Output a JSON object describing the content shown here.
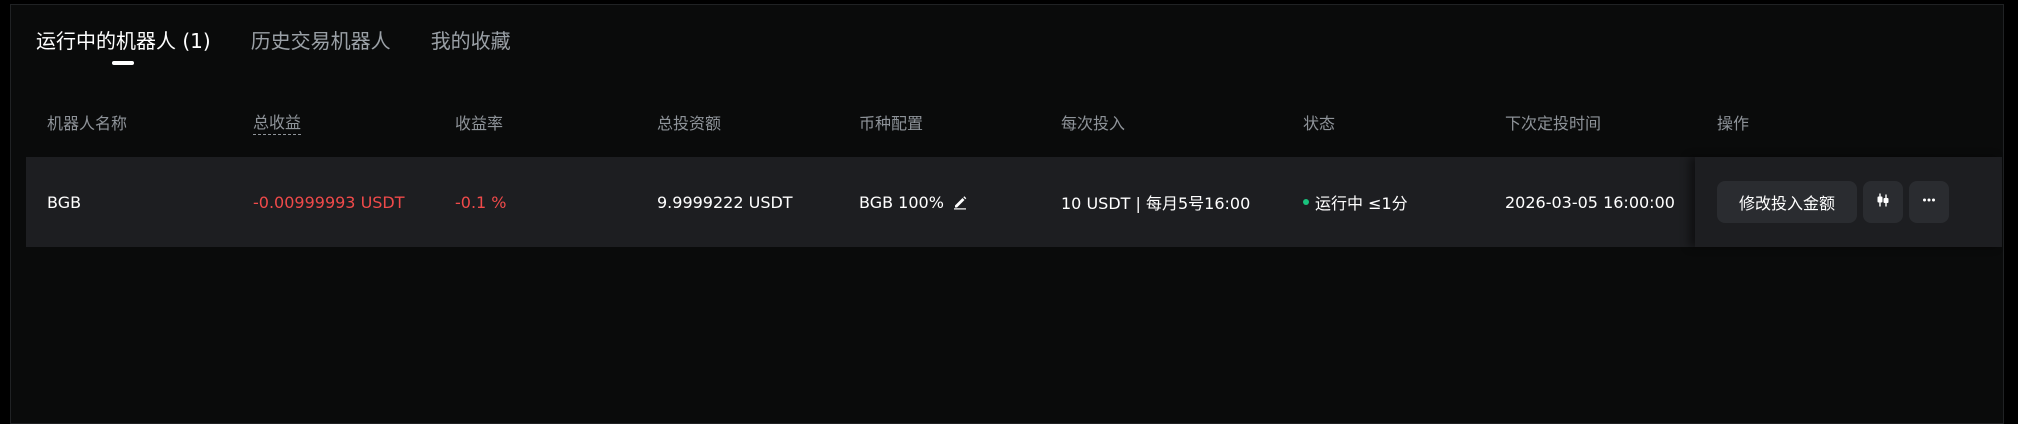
{
  "tabs": [
    {
      "label": "运行中的机器人 (1)",
      "active": true
    },
    {
      "label": "历史交易机器人",
      "active": false
    },
    {
      "label": "我的收藏",
      "active": false
    }
  ],
  "table": {
    "headers": {
      "name": "机器人名称",
      "total_profit": "总收益",
      "profit_rate": "收益率",
      "total_investment": "总投资额",
      "currency_allocation": "币种配置",
      "per_investment": "每次投入",
      "status": "状态",
      "next_investment_time": "下次定投时间",
      "actions": "操作"
    },
    "rows": [
      {
        "name": "BGB",
        "total_profit": "-0.00999993 USDT",
        "profit_rate": "-0.1 %",
        "total_investment": "9.9999222 USDT",
        "currency_allocation": "BGB 100%",
        "per_investment": "10 USDT | 每月5号16:00",
        "status": "运行中 ≤1分",
        "next_investment_time": "2026-03-05 16:00:00",
        "actions": {
          "modify_label": "修改投入金额",
          "chart_icon": "candlestick-chart-icon",
          "more_icon": "more-horizontal-icon"
        }
      }
    ]
  },
  "colors": {
    "negative": "#f04a4a",
    "status_running": "#19c37d",
    "row_background": "#1d1e21",
    "page_background": "#0a0b0b"
  }
}
